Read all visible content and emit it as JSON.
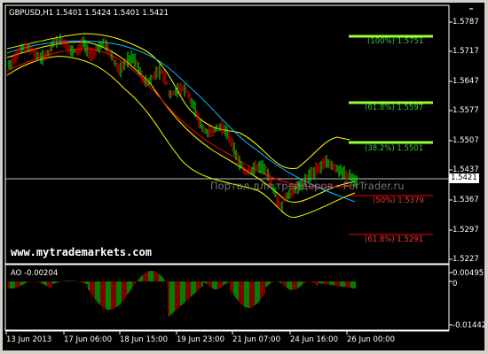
{
  "chart": {
    "header": "GBPUSD,H1  1.5401 1.5424 1.5401 1.5421",
    "collapse_button": "-",
    "watermark_site": "www.mytrademarkets.com",
    "watermark_portal": "Портал для трейдеров - ForTrader.ru",
    "current_price": "1.5421",
    "colors": {
      "background": "#000000",
      "candle_up": "#00ff00",
      "candle_down": "#ff0000",
      "envelope": "#ffff00",
      "ma_cyan": "#00bfff",
      "ma_red": "#ff0000"
    }
  },
  "price_axis": [
    "1.5787",
    "1.5717",
    "1.5647",
    "1.5577",
    "1.5507",
    "1.5437",
    "1.5367",
    "1.5297",
    "1.5227"
  ],
  "fib_levels": [
    {
      "label": "(100%) 1.5751",
      "color": "#33cc33",
      "line_color": "#99ff33"
    },
    {
      "label": "(61.8%) 1.5597",
      "color": "#33cc33",
      "line_color": "#99ff33"
    },
    {
      "label": "(38.2%) 1.5501",
      "color": "#33cc33",
      "line_color": "#99ff33"
    },
    {
      "label": "(50%) 1.5379",
      "color": "#ff3333",
      "line_color": "#ff0000"
    },
    {
      "label": "(61.8%) 1.5291",
      "color": "#ff3333",
      "line_color": "#ff0000"
    }
  ],
  "ao": {
    "label": "AO -0.00204",
    "axis": [
      "0.00495",
      "0",
      "-0.01442"
    ]
  },
  "time_axis": [
    "13 Jun 2013",
    "17 Jun 06:00",
    "18 Jun 15:00",
    "19 Jun 23:00",
    "21 Jun 07:00",
    "24 Jun 16:00",
    "26 Jun 00:00"
  ]
}
